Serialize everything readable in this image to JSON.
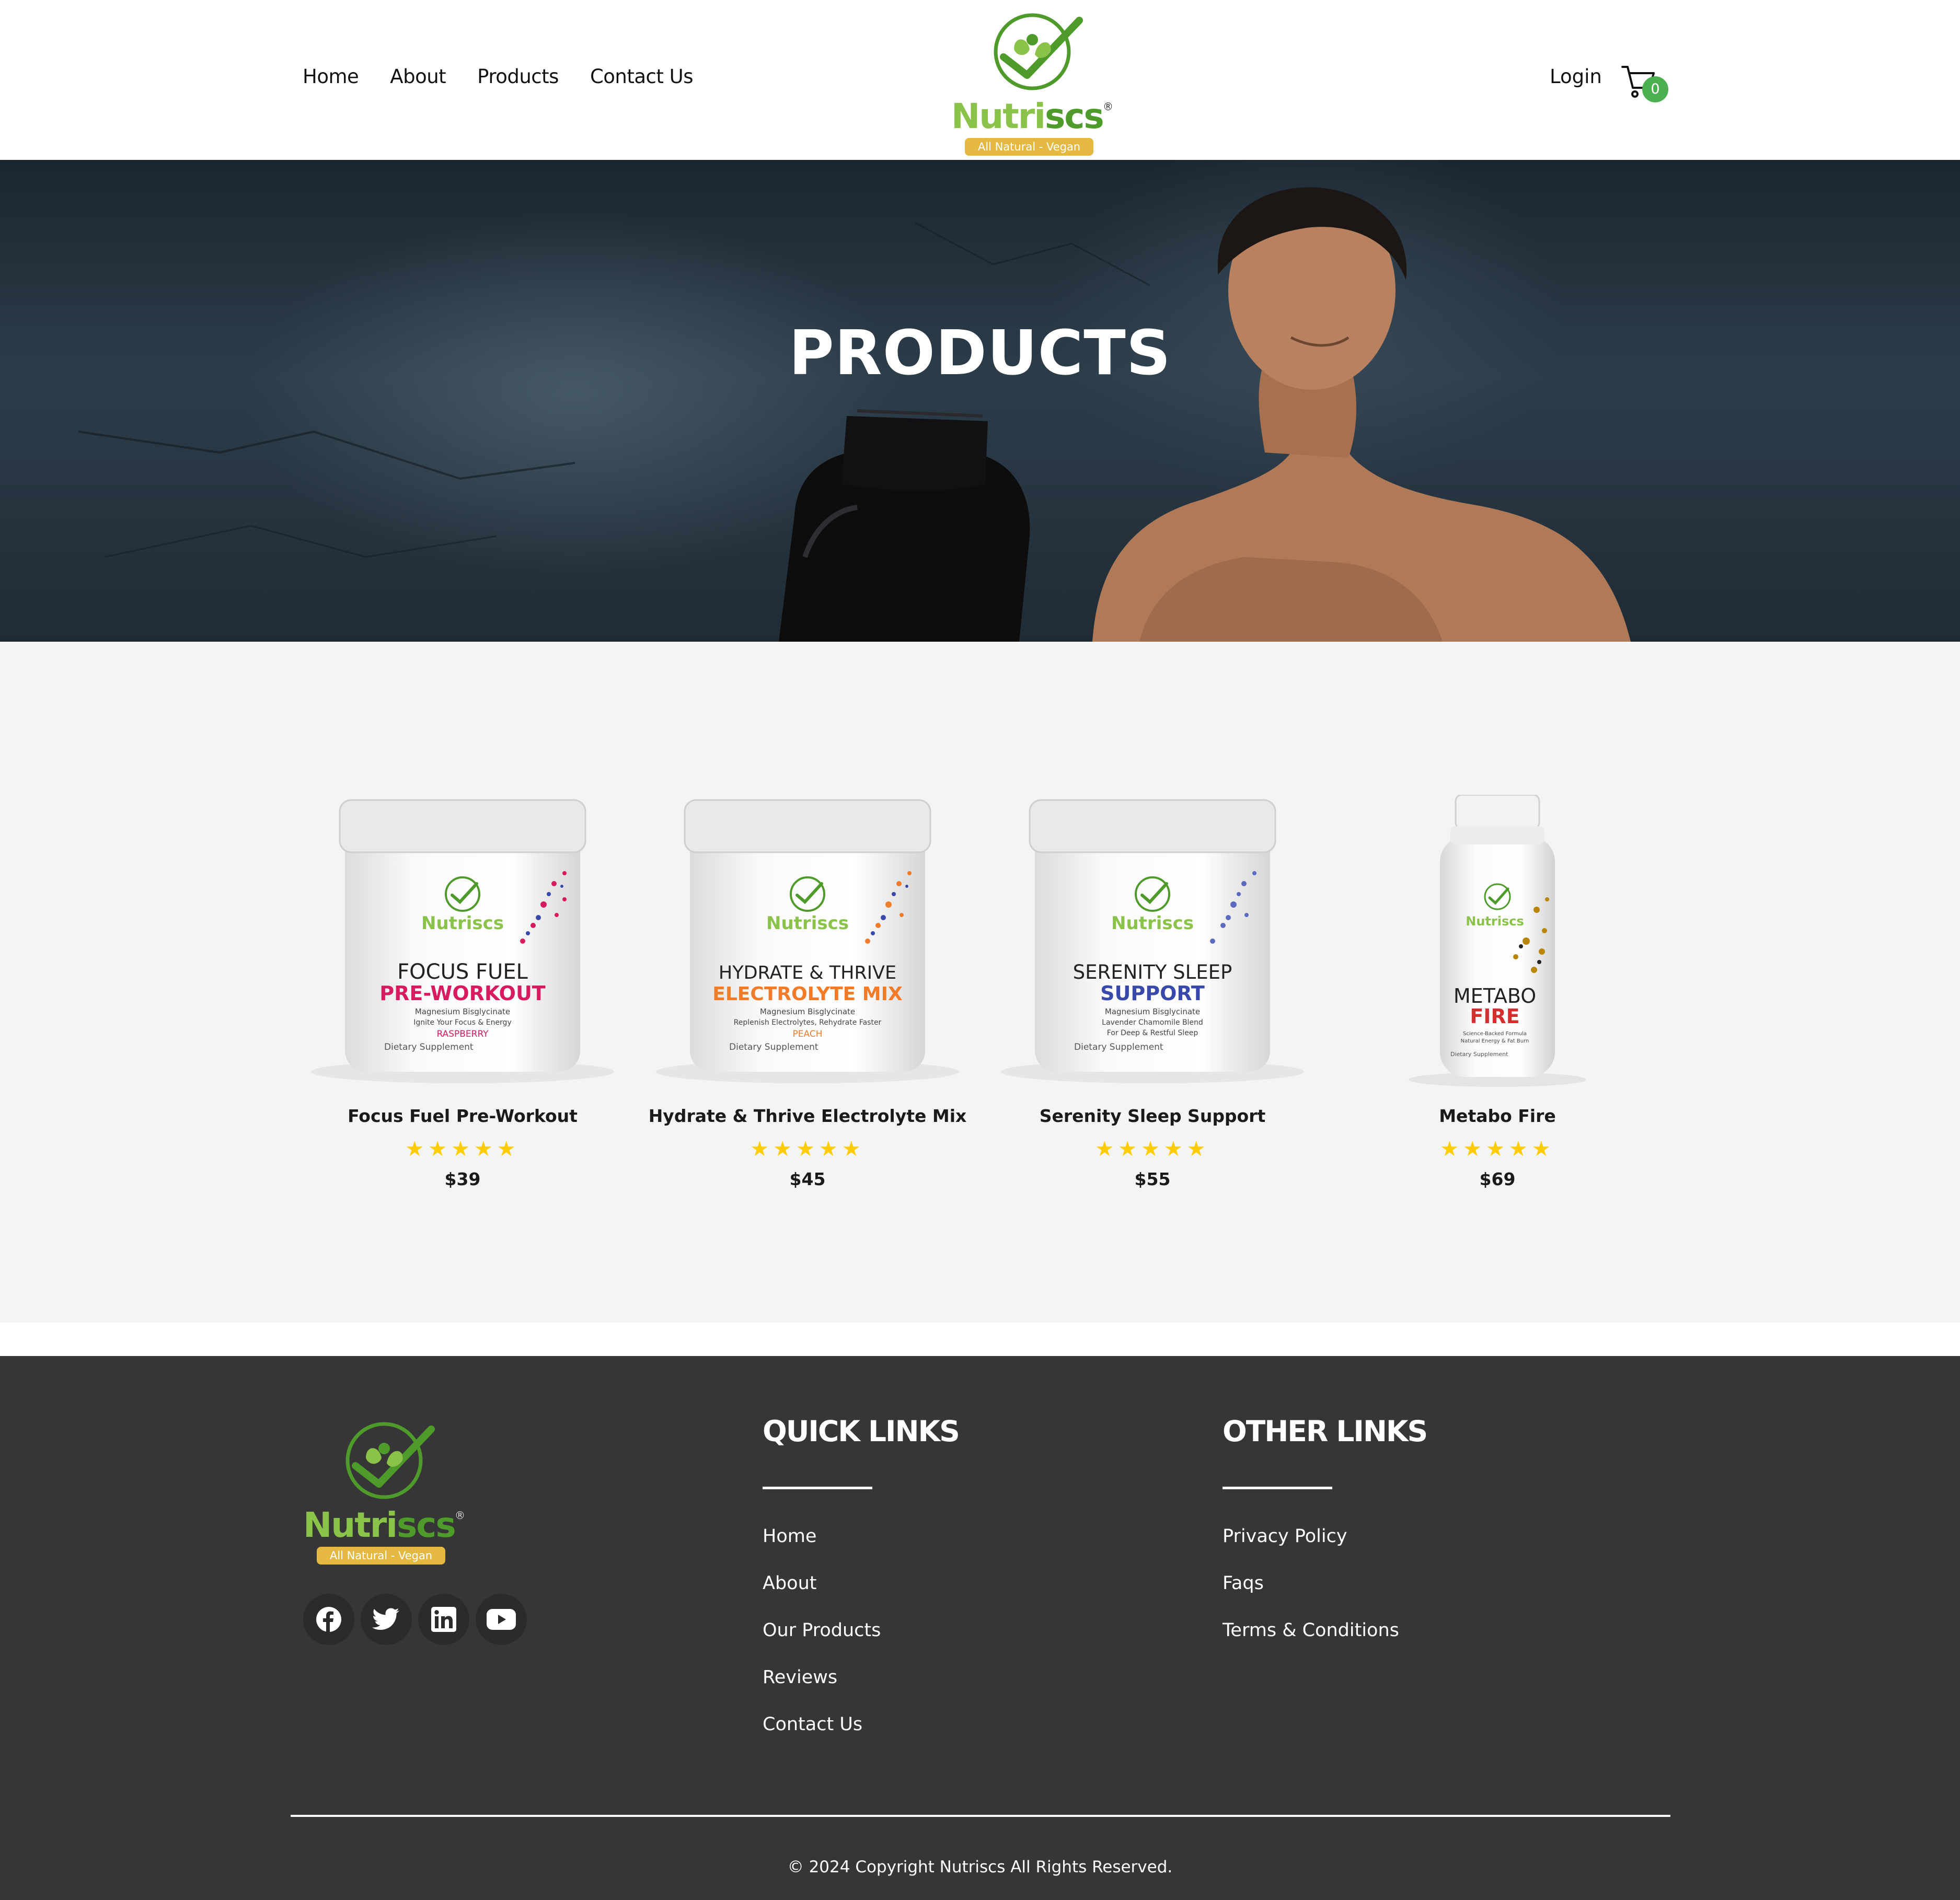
{
  "header": {
    "nav": [
      {
        "label": "Home"
      },
      {
        "label": "About"
      },
      {
        "label": "Products"
      },
      {
        "label": "Contact Us"
      }
    ],
    "logo": {
      "brand_a": "Nutri",
      "brand_b": "scs",
      "reg": "®",
      "tagline": "All Natural - Vegan"
    },
    "login_label": "Login",
    "cart_count": "0",
    "brand_green": "#8bc34a",
    "brand_dark_green": "#4e9a2a",
    "brand_gold": "#e5b941"
  },
  "hero": {
    "title": "PRODUCTS"
  },
  "products": [
    {
      "name": "Focus Fuel Pre-Workout",
      "stars": "★★★★★",
      "rating": 5,
      "price": "$39",
      "label_line1": "FOCUS FUEL",
      "label_line2": "PRE-WORKOUT",
      "label_sub1": "Magnesium Bisglycinate",
      "label_sub2": "Ignite Your Focus & Energy",
      "flavor": "RASPBERRY",
      "footer": "Dietary Supplement",
      "accent": "#d81b60"
    },
    {
      "name": "Hydrate & Thrive Electrolyte Mix",
      "stars": "★★★★★",
      "rating": 5,
      "price": "$45",
      "label_line1": "HYDRATE & THRIVE",
      "label_line2": "ELECTROLYTE MIX",
      "label_sub1": "Magnesium Bisglycinate",
      "label_sub2": "Replenish Electrolytes, Rehydrate Faster",
      "flavor": "PEACH",
      "footer": "Dietary Supplement",
      "accent": "#f07c2a"
    },
    {
      "name": "Serenity Sleep Support",
      "stars": "★★★★★",
      "rating": 5,
      "price": "$55",
      "label_line1": "SERENITY SLEEP",
      "label_line2": "SUPPORT",
      "label_sub1": "Magnesium Bisglycinate",
      "label_sub2": "Lavender Chamomile Blend",
      "flavor": "For Deep & Restful Sleep",
      "footer": "Dietary Supplement",
      "accent": "#3949ab"
    },
    {
      "name": "Metabo Fire",
      "stars": "★★★★★",
      "rating": 5,
      "price": "$69",
      "label_line1": "METABO",
      "label_line2": "FIRE",
      "label_sub1": "Science-Backed Formula",
      "label_sub2": "Natural Energy & Fat Burn",
      "flavor": "",
      "footer": "Dietary Supplement",
      "accent": "#d32f2f"
    }
  ],
  "footer": {
    "logo": {
      "brand_a": "Nutri",
      "brand_b": "scs",
      "reg": "®",
      "tagline": "All Natural - Vegan"
    },
    "socials": [
      {
        "icon": "facebook-icon"
      },
      {
        "icon": "twitter-icon"
      },
      {
        "icon": "linkedin-icon"
      },
      {
        "icon": "youtube-icon"
      }
    ],
    "quick_links": {
      "title": "QUICK LINKS",
      "items": [
        "Home",
        "About",
        "Our Products",
        "Reviews",
        "Contact Us"
      ]
    },
    "other_links": {
      "title": "OTHER LINKS",
      "items": [
        "Privacy Policy",
        "Faqs",
        "Terms & Conditions"
      ]
    },
    "copyright": "© 2024 Copyright Nutriscs All Rights Reserved.",
    "background": "#363636"
  }
}
